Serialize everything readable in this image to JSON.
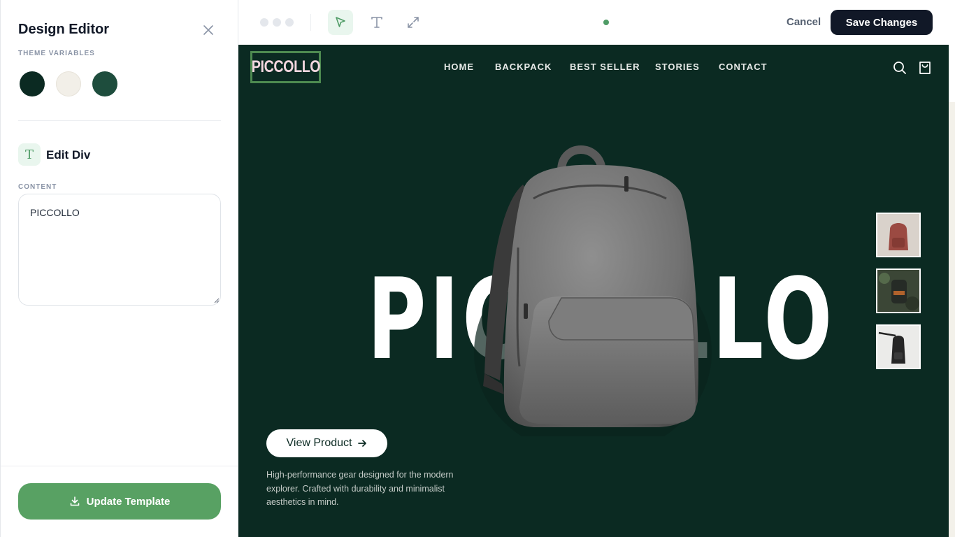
{
  "editor": {
    "title": "Design Editor",
    "theme_label": "THEME VARIABLES",
    "theme_colors": [
      "#0b2a22",
      "#f2efe8",
      "#1e4d3d"
    ],
    "edit_badge": "T",
    "edit_title": "Edit Div",
    "content_label": "CONTENT",
    "content_value": "PICCOLLO",
    "update_button": "Update Template"
  },
  "toolbar": {
    "tools": [
      "cursor-icon",
      "text-icon",
      "expand-icon"
    ],
    "cancel": "Cancel",
    "save": "Save Changes",
    "status_color": "#4f9c66"
  },
  "site": {
    "logo": "PICCOLLO",
    "nav": [
      "HOME",
      "BACKPACK",
      "BEST SELLER",
      "STORIES",
      "CONTACT"
    ],
    "hero_word": "PICCOLLO",
    "view_button": "View Product",
    "description": "High-performance gear designed for the modern explorer. Crafted with durability and minimalist aesthetics in mind.",
    "colors": {
      "background": "#0b2a22",
      "logo_border": "#4d8a50",
      "logo_text": "#f2d7df"
    }
  }
}
